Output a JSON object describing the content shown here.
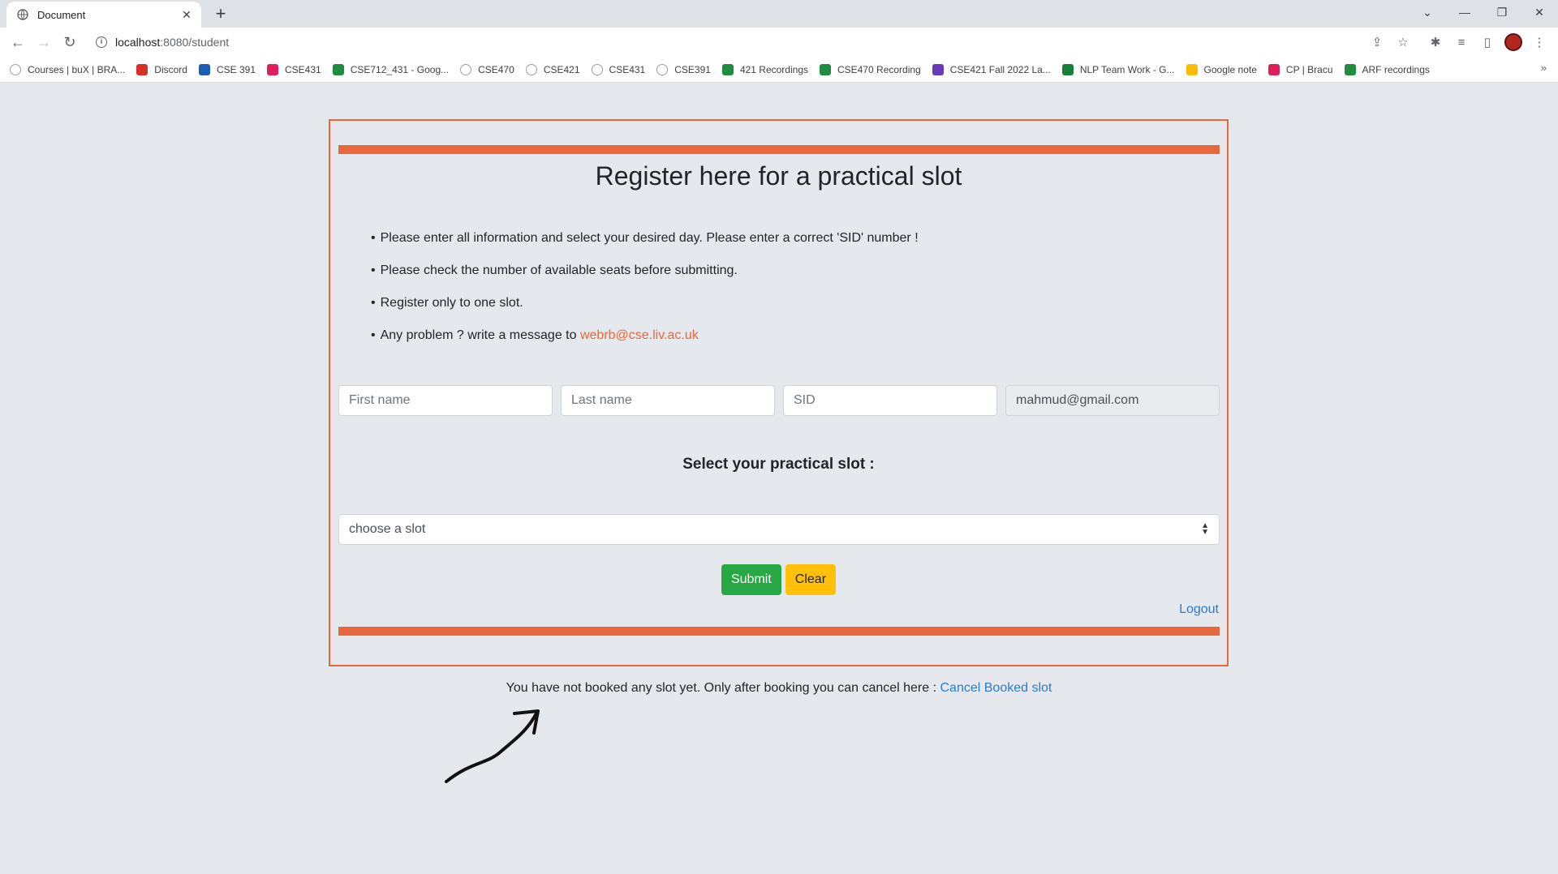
{
  "browser": {
    "tab_title": "Document",
    "url_host": "localhost",
    "url_path": ":8080/student",
    "bookmarks": [
      {
        "label": "Courses | buX | BRA...",
        "icon": "bux-icon",
        "color": "#9aa0a6"
      },
      {
        "label": "Discord",
        "icon": "discord-icon",
        "color": "#d93025"
      },
      {
        "label": "CSE 391",
        "icon": "p-icon",
        "color": "#1a5fb4"
      },
      {
        "label": "CSE431",
        "icon": "slack-icon",
        "color": "#e01e5a"
      },
      {
        "label": "CSE712_431 - Goog...",
        "icon": "drive-icon",
        "color": "#1e8e3e"
      },
      {
        "label": "CSE470",
        "icon": "bux-icon",
        "color": "#9aa0a6"
      },
      {
        "label": "CSE421",
        "icon": "bux-icon",
        "color": "#9aa0a6"
      },
      {
        "label": "CSE431",
        "icon": "bux-icon",
        "color": "#9aa0a6"
      },
      {
        "label": "CSE391",
        "icon": "bux-icon",
        "color": "#9aa0a6"
      },
      {
        "label": "421 Recordings",
        "icon": "drive-icon",
        "color": "#1e8e3e"
      },
      {
        "label": "CSE470 Recording",
        "icon": "drive-icon",
        "color": "#1e8e3e"
      },
      {
        "label": "CSE421 Fall 2022 La...",
        "icon": "forms-icon",
        "color": "#673ab7"
      },
      {
        "label": "NLP Team Work - G...",
        "icon": "sheets-icon",
        "color": "#188038"
      },
      {
        "label": "Google note",
        "icon": "keep-icon",
        "color": "#fbbc04"
      },
      {
        "label": "CP | Bracu",
        "icon": "slack-icon",
        "color": "#e01e5a"
      },
      {
        "label": "ARF recordings",
        "icon": "drive-icon",
        "color": "#1e8e3e"
      }
    ]
  },
  "page": {
    "heading": "Register here for a practical slot",
    "rules": [
      "Please enter all information and select your desired day. Please enter a correct 'SID' number !",
      "Please check the number of available seats before submitting.",
      "Register only to one slot."
    ],
    "contact_prefix": "Any problem ? write a message to ",
    "contact_email": "webrb@cse.liv.ac.uk",
    "first_name_placeholder": "First name",
    "last_name_placeholder": "Last name",
    "sid_placeholder": "SID",
    "email_value": "mahmud@gmail.com",
    "slot_title": "Select your practical slot :",
    "slot_selected": "choose a slot",
    "submit_label": "Submit",
    "clear_label": "Clear",
    "logout_label": "Logout",
    "cancel_text": "You have not booked any slot yet. Only after booking you can cancel here : ",
    "cancel_link": "Cancel Booked slot"
  },
  "colors": {
    "accent": "#e8673c",
    "submit": "#28a745",
    "clear": "#ffc107",
    "link": "#2a7bd4"
  }
}
